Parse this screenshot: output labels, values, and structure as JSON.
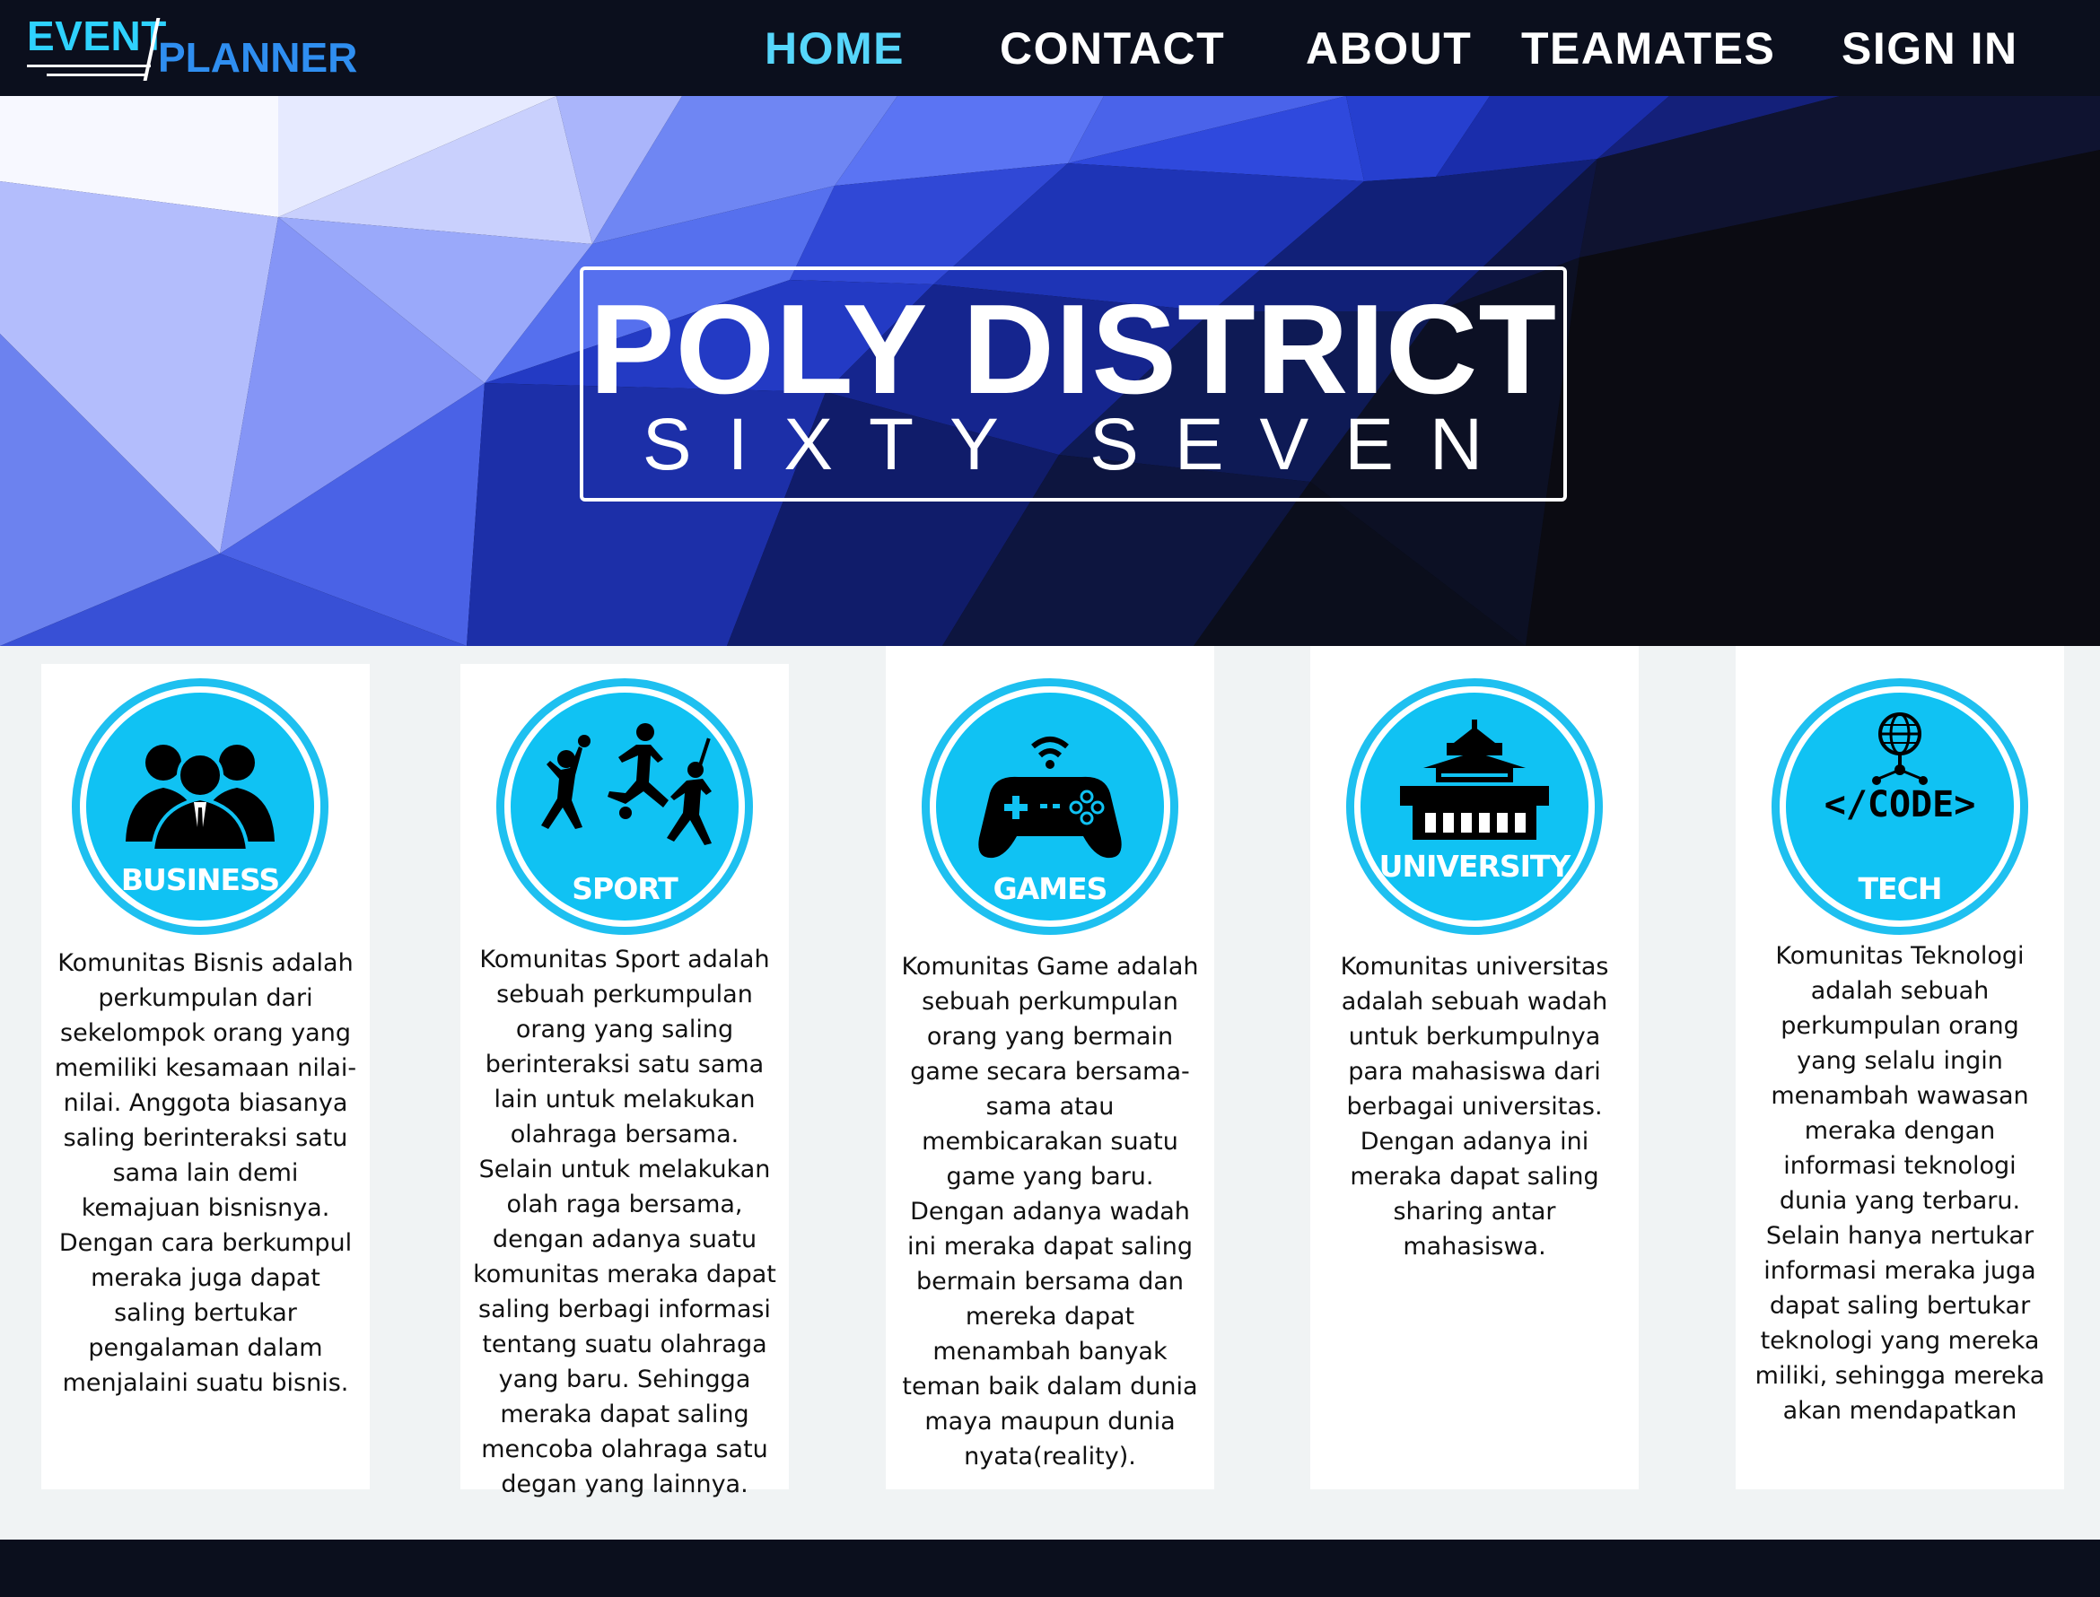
{
  "logo": {
    "event": "EVENT",
    "planner": "PLANNER"
  },
  "nav": {
    "home": "HOME",
    "contact": "CONTACT",
    "about": "ABOUT",
    "teamates": "TEAMATES",
    "sign_in": "SIGN IN",
    "active": "HOME"
  },
  "hero": {
    "title": "POLY DISTRICT",
    "subtitle": "SIXTY SEVEN"
  },
  "colors": {
    "nav_bg": "#0b0f1d",
    "accent": "#56d6fb",
    "badge": "#10c2f3",
    "page_bg": "#f0f3f4"
  },
  "cards": [
    {
      "label": "BUSINESS",
      "icon": "business-people-icon",
      "text": "Komunitas Bisnis adalah perkumpulan dari sekelompok orang yang memiliki kesamaan nilai-nilai. Anggota biasanya saling berinteraksi satu sama lain demi kemajuan bisnisnya. Dengan cara berkumpul meraka juga dapat saling bertukar pengalaman dalam menjalaini suatu bisnis."
    },
    {
      "label": "SPORT",
      "icon": "athletes-icon",
      "text": "Komunitas Sport adalah sebuah perkumpulan orang yang saling berinteraksi satu sama lain untuk melakukan olahraga bersama. Selain untuk melakukan olah raga bersama, dengan adanya suatu komunitas meraka dapat saling berbagi informasi tentang suatu olahraga yang baru. Sehingga meraka dapat saling mencoba olahraga satu degan yang lainnya."
    },
    {
      "label": "GAMES",
      "icon": "gamepad-icon",
      "text": "Komunitas Game adalah sebuah perkumpulan orang yang bermain game secara bersama-sama atau membicarakan suatu game yang baru. Dengan adanya wadah ini meraka dapat saling bermain bersama dan mereka dapat menambah banyak teman baik dalam dunia maya maupun dunia nyata(reality)."
    },
    {
      "label": "UNIVERSITY",
      "icon": "university-building-icon",
      "text": "Komunitas universitas adalah sebuah wadah untuk berkumpulnya para mahasiswa dari berbagai universitas. Dengan adanya ini meraka dapat saling sharing antar mahasiswa."
    },
    {
      "label": "TECH",
      "icon": "code-network-icon",
      "code_text": "</CODE>",
      "text": "Komunitas Teknologi adalah sebuah perkumpulan orang yang selalu ingin menambah wawasan meraka dengan informasi teknologi dunia yang terbaru. Selain hanya nertukar informasi meraka juga dapat saling bertukar teknologi yang mereka miliki, sehingga mereka akan mendapatkan"
    }
  ]
}
